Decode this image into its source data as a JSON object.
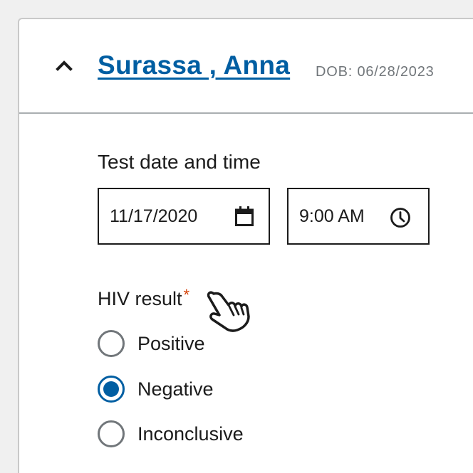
{
  "patient": {
    "name": "Surassa , Anna",
    "dob": "DOB: 06/28/2023"
  },
  "test_datetime": {
    "label": "Test date and time",
    "date_value": "11/17/2020",
    "time_value": "9:00 AM"
  },
  "hiv_result": {
    "label": "HIV result",
    "required_mark": "*",
    "options": [
      {
        "label": "Positive",
        "checked": false
      },
      {
        "label": "Negative",
        "checked": true
      },
      {
        "label": "Inconclusive",
        "checked": false
      }
    ]
  },
  "icons": {
    "toggle": "chevron-up-icon",
    "date": "calendar-icon",
    "time": "clock-icon",
    "cursor": "pointer-hand-icon"
  },
  "colors": {
    "link": "#005ea2",
    "required": "#d54309",
    "radio_selected": "#005ea2",
    "muted": "#71767a"
  }
}
